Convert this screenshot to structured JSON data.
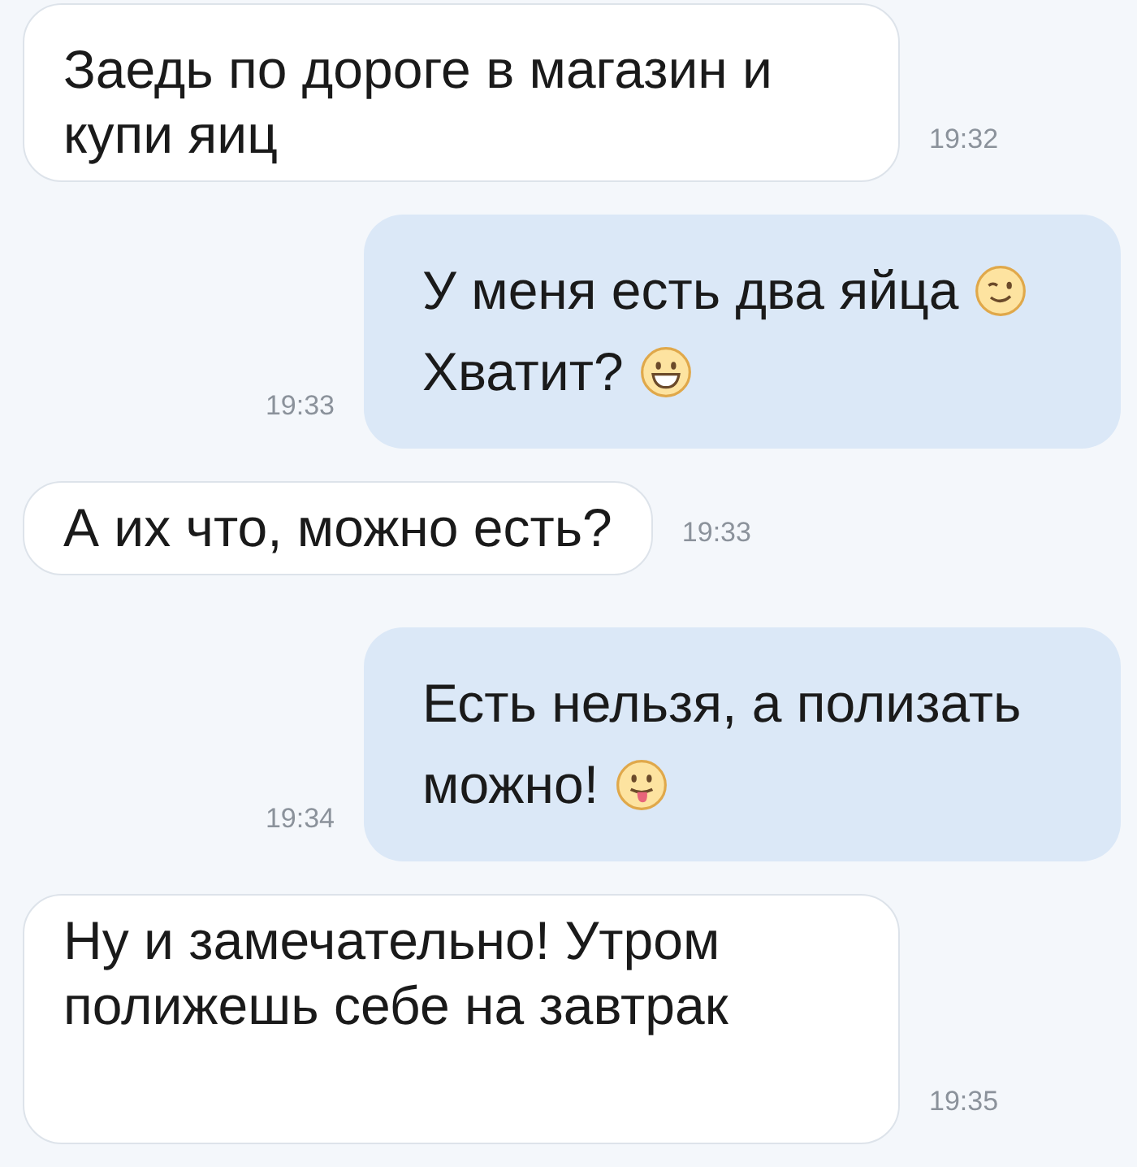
{
  "messages": [
    {
      "kind": "incoming",
      "segments": [
        {
          "text": "Заедь по дороге в магазин и купи яиц"
        }
      ],
      "time": "19:32"
    },
    {
      "kind": "outgoing",
      "segments": [
        {
          "text": "У меня есть два яйца",
          "kind": "wink"
        },
        {
          "text": "Хватит?",
          "kind": "grin"
        }
      ],
      "time": "19:33"
    },
    {
      "kind": "incoming",
      "segments": [
        {
          "text": "А их что, можно есть?"
        }
      ],
      "time": "19:33"
    },
    {
      "kind": "outgoing",
      "segments": [
        {
          "text": "Есть нельзя, а полизать"
        },
        {
          "text": "можно!",
          "kind": "tongue"
        }
      ],
      "time": "19:34"
    },
    {
      "kind": "incoming",
      "segments": [
        {
          "text": "Ну и замечательно! Утром полижешь себе на завтрак"
        }
      ],
      "time": "19:35"
    }
  ]
}
